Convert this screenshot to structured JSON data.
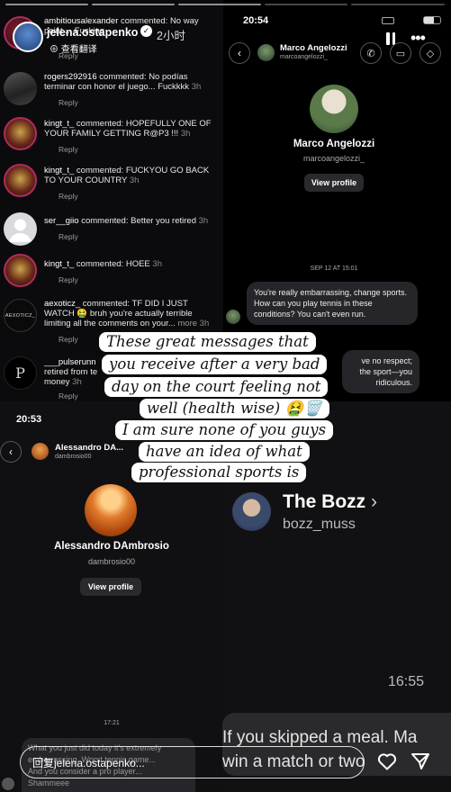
{
  "story": {
    "username": "jelena.ostapenko",
    "translate_label": "查看翻译",
    "time": "2小时",
    "reply_placeholder": "回复jelena.ostapenko..."
  },
  "comments": [
    {
      "user": "ambitiousalexander",
      "text": "commented: No way",
      "text2": "point ... Fucking",
      "time": "",
      "reply": "Reply"
    },
    {
      "user": "rogers292916",
      "text": "commented: No podías terminar con honor el juego... Fuckkkk",
      "time": "3h",
      "reply": "Reply"
    },
    {
      "user": "kingt_t_",
      "text": "commented: HOPEFULLY ONE OF YOUR FAMILY GETTING R@P3 !!!",
      "time": "3h",
      "reply": "Reply"
    },
    {
      "user": "kingt_t_",
      "text": "commented: FUCKYOU GO BACK TO YOUR COUNTRY",
      "time": "3h",
      "reply": "Reply"
    },
    {
      "user": "ser__giio",
      "text": "commented: Better you retired",
      "time": "3h",
      "reply": "Reply"
    },
    {
      "user": "kingt_t_",
      "text": "commented: HOEE",
      "time": "3h",
      "reply": "Reply"
    },
    {
      "user": "aexoticz_",
      "text": "commented: TF DID I JUST WATCH 🤮 bruh you're actually terrible limiting all the comments on your...",
      "more": "more",
      "time": "3h",
      "reply": "Reply"
    },
    {
      "user": "___pulserunn",
      "text": "retired from te",
      "text2": "money",
      "time": "3h",
      "reply": "Reply"
    }
  ],
  "avatar_labels": {
    "aexoticz": "AEXOTICZ_",
    "pulse": "P"
  },
  "dm1": {
    "status_time": "20:54",
    "name": "Marco Angelozzi",
    "handle": "marcoangelozzi_",
    "view_profile": "View profile",
    "date": "SEP 12 AT 15:01",
    "message": "You're really embarrassing, change sports. How can you play tennis in these conditions? You can't even run.",
    "message2_fragments": [
      "ve no respect;",
      "the sport—you",
      "ridiculous."
    ]
  },
  "dm2": {
    "status_time": "20:53",
    "name": "Alessandro DA...",
    "handle": "dambrosio00",
    "full_name": "Alessandro DAmbrosio",
    "view_profile": "View profile",
    "time": "17:21",
    "messages": [
      "What you just did today it's extremely",
      "embarrassing. Worst tennis game...",
      "And you consider a pro player...",
      "Shammeee"
    ]
  },
  "dm3": {
    "name": "The Bozz",
    "handle": "bozz_muss",
    "time": "16:55",
    "message": "If you skipped a meal. Ma win a match or two"
  },
  "caption_lines": [
    "These great messages that",
    "you receive after a very bad",
    "day on the court feeling not",
    "well (health wise) 🤮🗑️",
    "I am sure none of you guys",
    "have an idea of what",
    "professional sports is"
  ],
  "colors": {
    "ring": "#b52a5c",
    "bubble": "#26262a",
    "caption_bg": "#ffffff"
  }
}
